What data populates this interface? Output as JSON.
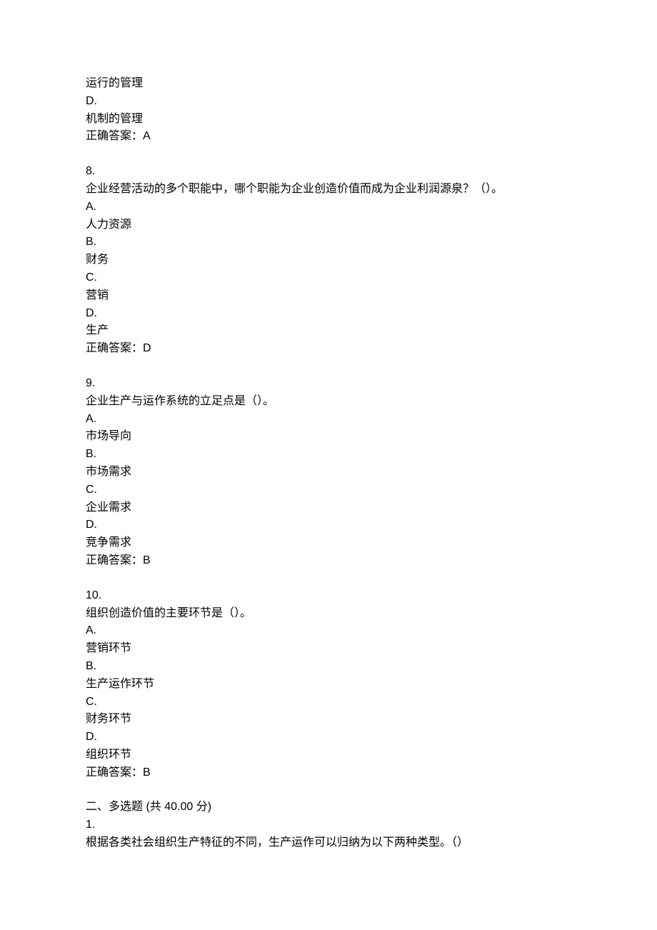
{
  "frag7": {
    "c_line": "运行的管理",
    "d": "D.",
    "d_line": "机制的管理",
    "answer": "正确答案：A"
  },
  "q8": {
    "num": "8.",
    "stem": "企业经营活动的多个职能中，哪个职能为企业创造价值而成为企业利润源泉？（）。",
    "a": "A.",
    "a_line": "人力资源",
    "b": "B.",
    "b_line": "财务",
    "c": "C.",
    "c_line": "营销",
    "d": "D.",
    "d_line": "生产",
    "answer": "正确答案：D"
  },
  "q9": {
    "num": "9.",
    "stem": "企业生产与运作系统的立足点是（）。",
    "a": "A.",
    "a_line": "市场导向",
    "b": "B.",
    "b_line": "市场需求",
    "c": "C.",
    "c_line": "企业需求",
    "d": "D.",
    "d_line": "竞争需求",
    "answer": "正确答案：B"
  },
  "q10": {
    "num": "10.",
    "stem": "组织创造价值的主要环节是（）。",
    "a": "A.",
    "a_line": "营销环节",
    "b": "B.",
    "b_line": "生产运作环节",
    "c": "C.",
    "c_line": "财务环节",
    "d": "D.",
    "d_line": "组织环节",
    "answer": "正确答案：B"
  },
  "section2": {
    "title": "二、多选题 (共 40.00 分)",
    "q1_num": "1.",
    "q1_stem": "根据各类社会组织生产特征的不同，生产运作可以归纳为以下两种类型。（）"
  }
}
